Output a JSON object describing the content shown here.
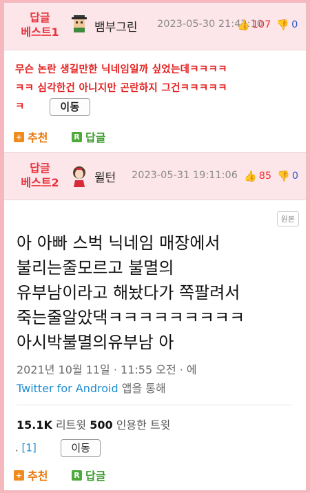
{
  "comments": [
    {
      "best_label_1": "답글",
      "best_label_2": "베스트1",
      "nickname": "뱀부그린",
      "date": "2023-05-30 21:42:10",
      "up": "107",
      "down": "0",
      "lines": [
        "무슨 논란 생길만한 닉네임일까 싶었는데ㅋㅋㅋㅋ",
        "ㅋㅋ 심각한건 아니지만 곤란하지 그건ㅋㅋㅋㅋㅋ",
        "ㅋ"
      ],
      "move_label": "이동",
      "recommend_label": "추천",
      "reply_label": "답글"
    },
    {
      "best_label_1": "답글",
      "best_label_2": "베스트2",
      "nickname": "윌턴",
      "date": "2023-05-31 19:11:06",
      "up": "85",
      "down": "0",
      "original_label": "원본",
      "tweet_lines": [
        "아 아빠 스벅 닉네임 매장에서",
        "불리는줄모르고 불멸의",
        "유부남이라고 해놨다가 쪽팔려서",
        "죽는줄알았댁ㅋㅋㅋㅋㅋㅋㅋㅋㅋ",
        "아시박불멸의유부남 아"
      ],
      "tweet_date": "2021년 10월 11일 · 11:55 오전 · 에",
      "tweet_client": "Twitter for Android",
      "tweet_client_suffix": " 앱을 통해",
      "retweets": "15.1K",
      "retweets_label": " 리트윗  ",
      "quotes": "500",
      "quotes_label": " 인용한 트윗",
      "ref_prefix": ". ",
      "ref_link": "[1]",
      "move_label": "이동",
      "recommend_label": "추천",
      "reply_label": "답글"
    }
  ],
  "icons": {
    "thumb_up": "👍",
    "thumb_down": "👎",
    "recommend_icon": "+",
    "reply_icon": "R"
  },
  "colors": {
    "best_red": "#e8323c",
    "up_red": "#e33",
    "down_blue": "#2a56c6",
    "recommend_orange": "#e8770c",
    "reply_green": "#3c9a2c",
    "header_pink": "#fde6ea",
    "border_pink": "#f5b8bf"
  }
}
